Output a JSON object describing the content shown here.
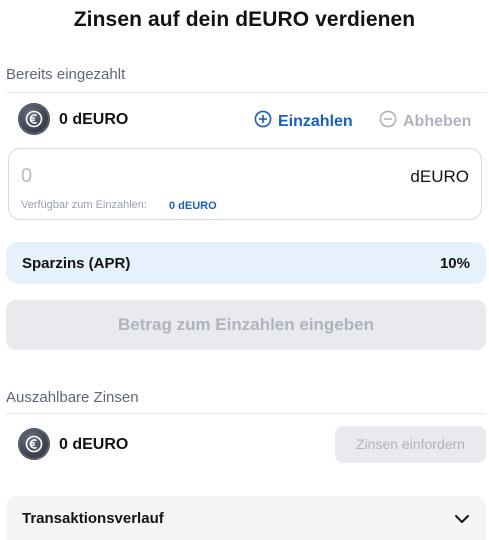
{
  "page": {
    "title": "Zinsen auf dein dEURO verdienen"
  },
  "deposit_section": {
    "label": "Bereits eingezahlt",
    "coin_icon": "deuro-coin-icon",
    "balance": "0 dEURO",
    "deposit_label": "Einzahlen",
    "deposit_icon": "plus-circle-icon",
    "withdraw_label": "Abheben",
    "withdraw_icon": "minus-circle-icon"
  },
  "amount_input": {
    "placeholder": "0",
    "value": "",
    "unit": "dEURO",
    "available_label": "Verfügbar zum Einzahlen:",
    "available_value": "0 dEURO"
  },
  "rate": {
    "label": "Sparzins (APR)",
    "value": "10%"
  },
  "submit": {
    "label": "Betrag zum Einzahlen eingeben"
  },
  "interest_section": {
    "label": "Auszahlbare Zinsen",
    "coin_icon": "deuro-coin-icon",
    "balance": "0 dEURO",
    "claim_label": "Zinsen einfordern"
  },
  "history": {
    "label": "Transaktionsverlauf",
    "toggle_icon": "chevron-down-icon"
  },
  "colors": {
    "accent": "#1b5fb8",
    "disabled_text": "#aeb3bd",
    "disabled_bg": "#e8eaee",
    "rate_bg": "#e6f1fb",
    "muted_text": "#5f6776"
  }
}
